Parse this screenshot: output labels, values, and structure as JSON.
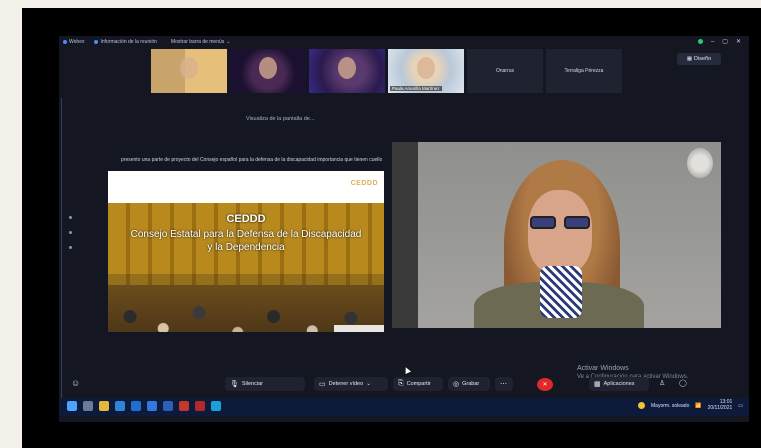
{
  "window": {
    "title": "Webex",
    "meeting_info": "Información de la reunión",
    "view_mode": "Mostrar barra de menús"
  },
  "thumbnails": [
    {
      "name": ""
    },
    {
      "name": ""
    },
    {
      "name": ""
    },
    {
      "name": "Paula Amarilla Martínez"
    }
  ],
  "named_participants": [
    "Onarrus",
    "Terraliga Pérezza"
  ],
  "layout_button": {
    "label": "Diseño"
  },
  "share_notice": "Visualiza de la pantalla de...",
  "presentation_caption": "presento una parte de proyecto del Consejo español para la defensa de la discapacidad importancia que tienen cuello",
  "slide": {
    "logo": "CEDDD",
    "title": "CEDDD",
    "subtitle": "Consejo Estatal para la Defensa de la Discapacidad y la Dependencia"
  },
  "watermark": {
    "title": "Activar Windows",
    "text": "Ve a Configuración para activar Windows."
  },
  "controls": {
    "mute": "Silenciar",
    "stop_video": "Detener vídeo",
    "share": "Compartir",
    "record": "Grabar",
    "apps": "Aplicaciones"
  },
  "taskbar": {
    "weather": "Mayorm. soleado",
    "time": "13:01",
    "date": "20/11/2021"
  },
  "colors": {
    "meeting_bg": "#141722",
    "hangup": "#e02828",
    "taskbar": "#0e1a3a"
  }
}
